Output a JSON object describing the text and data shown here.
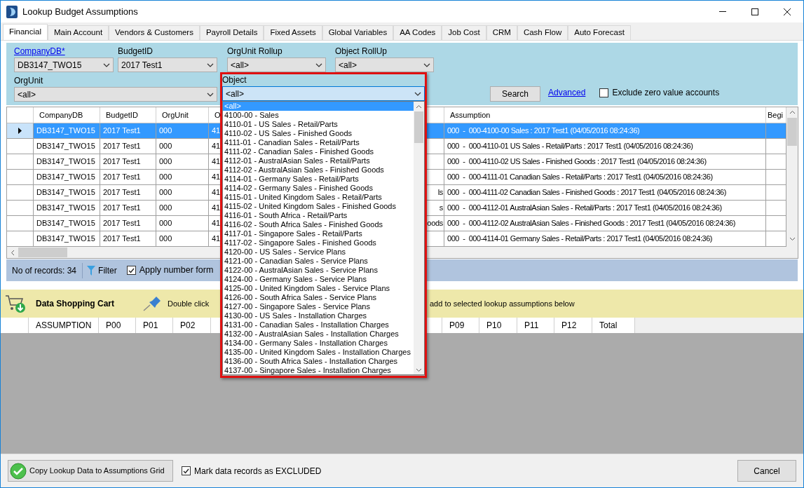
{
  "window": {
    "title": "Lookup Budget Assumptions"
  },
  "tabs": [
    {
      "label": "Financial",
      "selected": true
    },
    {
      "label": "Main Account",
      "selected": false
    },
    {
      "label": "Vendors & Customers",
      "selected": false
    },
    {
      "label": "Payroll Details",
      "selected": false
    },
    {
      "label": "Fixed Assets",
      "selected": false
    },
    {
      "label": "Global Variables",
      "selected": false
    },
    {
      "label": "AA Codes",
      "selected": false
    },
    {
      "label": "Job Cost",
      "selected": false
    },
    {
      "label": "CRM",
      "selected": false
    },
    {
      "label": "Cash Flow",
      "selected": false
    },
    {
      "label": "Auto Forecast",
      "selected": false
    }
  ],
  "filters": {
    "company_db": {
      "label": "CompanyDB*",
      "value": "DB3147_TWO15"
    },
    "budget_id": {
      "label": "BudgetID",
      "value": "2017 Test1"
    },
    "orgunit_rollup": {
      "label": "OrgUnit Rollup",
      "value": "<all>"
    },
    "object_rollup": {
      "label": "Object RollUp",
      "value": "<all>"
    },
    "orgunit": {
      "label": "OrgUnit",
      "value": "<all>"
    },
    "object": {
      "label": "Object",
      "value": "<all>",
      "expanded": true,
      "options": [
        {
          "label": "<all>",
          "selected": true
        },
        {
          "label": "4100-00 - Sales",
          "selected": false
        },
        {
          "label": "4110-01 - US Sales - Retail/Parts",
          "selected": false
        },
        {
          "label": "4110-02 - US Sales - Finished Goods",
          "selected": false
        },
        {
          "label": "4111-01 - Canadian Sales - Retail/Parts",
          "selected": false
        },
        {
          "label": "4111-02 - Canadian Sales - Finished Goods",
          "selected": false
        },
        {
          "label": "4112-01 - AustralAsian Sales - Retail/Parts",
          "selected": false
        },
        {
          "label": "4112-02 - AustralAsian Sales - Finished Goods",
          "selected": false
        },
        {
          "label": "4114-01 - Germany Sales - Retail/Parts",
          "selected": false
        },
        {
          "label": "4114-02 - Germany Sales - Finished Goods",
          "selected": false
        },
        {
          "label": "4115-01 - United Kingdom Sales - Retail/Parts",
          "selected": false
        },
        {
          "label": "4115-02 - United Kingdom Sales - Finished Goods",
          "selected": false
        },
        {
          "label": "4116-01 - South Africa - Retail/Parts",
          "selected": false
        },
        {
          "label": "4116-02 - South Africa Sales - Finished Goods",
          "selected": false
        },
        {
          "label": "4117-01 - Singapore Sales - Retail/Parts",
          "selected": false
        },
        {
          "label": "4117-02 - Singapore Sales - Finished Goods",
          "selected": false
        },
        {
          "label": "4120-00 - US Sales - Service Plans",
          "selected": false
        },
        {
          "label": "4121-00 - Canadian Sales - Service Plans",
          "selected": false
        },
        {
          "label": "4122-00 - AustralAsian Sales - Service Plans",
          "selected": false
        },
        {
          "label": "4124-00 - Germany Sales - Service Plans",
          "selected": false
        },
        {
          "label": "4125-00 - United Kingdom Sales - Service Plans",
          "selected": false
        },
        {
          "label": "4126-00 - South Africa Sales - Service Plans",
          "selected": false
        },
        {
          "label": "4127-00 - Singapore Sales - Service Plans",
          "selected": false
        },
        {
          "label": "4130-00 - US Sales - Installation Charges",
          "selected": false
        },
        {
          "label": "4131-00 - Canadian Sales - Installation Charges",
          "selected": false
        },
        {
          "label": "4132-00 - AustralAsian Sales - Installation Charges",
          "selected": false
        },
        {
          "label": "4134-00 - Germany Sales - Installation Charges",
          "selected": false
        },
        {
          "label": "4135-00 - United Kingdom Sales - Installation Charges",
          "selected": false
        },
        {
          "label": "4136-00 - South Africa Sales - Installation Charges",
          "selected": false
        },
        {
          "label": "4137-00 - Singapore Sales - Installation Charges",
          "selected": false
        }
      ]
    },
    "search_button": "Search",
    "advanced_link": "Advanced",
    "exclude_zero": {
      "label": "Exclude zero value accounts",
      "checked": false
    }
  },
  "grid": {
    "columns": [
      "CompanyDB",
      "BudgetID",
      "OrgUnit",
      "O",
      null,
      "Assumption",
      "Begi"
    ],
    "rows": [
      {
        "selected": true,
        "cells": [
          "DB3147_TWO15",
          "2017 Test1",
          "000",
          "41",
          null,
          "000  -  000-4100-00 Sales : 2017 Test1 (04/05/2016 08:24:36)"
        ]
      },
      {
        "selected": false,
        "cells": [
          "DB3147_TWO15",
          "2017 Test1",
          "000",
          "41",
          null,
          "000  -  000-4110-01 US Sales - Retail/Parts : 2017 Test1 (04/05/2016 08:24:36)"
        ]
      },
      {
        "selected": false,
        "cells": [
          "DB3147_TWO15",
          "2017 Test1",
          "000",
          "41",
          null,
          "000  -  000-4110-02 US Sales - Finished Goods : 2017 Test1 (04/05/2016 08:24:36)"
        ]
      },
      {
        "selected": false,
        "cells": [
          "DB3147_TWO15",
          "2017 Test1",
          "000",
          "41",
          null,
          "000  -  000-4111-01 Canadian Sales - Retail/Parts : 2017 Test1 (04/05/2016 08:24:36)"
        ]
      },
      {
        "selected": false,
        "cells": [
          "DB3147_TWO15",
          "2017 Test1",
          "000",
          "41",
          "ls",
          "000  -  000-4111-02 Canadian Sales - Finished Goods : 2017 Test1 (04/05/2016 08:24:36)"
        ]
      },
      {
        "selected": false,
        "cells": [
          "DB3147_TWO15",
          "2017 Test1",
          "000",
          "41",
          "s",
          "000  -  000-4112-01 AustralAsian Sales - Retail/Parts : 2017 Test1 (04/05/2016 08:24:36)"
        ]
      },
      {
        "selected": false,
        "cells": [
          "DB3147_TWO15",
          "2017 Test1",
          "000",
          "41",
          "oods",
          "000  -  000-4112-02 AustralAsian Sales - Finished Goods : 2017 Test1 (04/05/2016 08:24:36)"
        ]
      },
      {
        "selected": false,
        "cells": [
          "DB3147_TWO15",
          "2017 Test1",
          "000",
          "41",
          null,
          "000  -  000-4114-01 Germany Sales - Retail/Parts : 2017 Test1 (04/05/2016 08:24:36)"
        ]
      }
    ]
  },
  "status_bar": {
    "records": "No of records: 34",
    "filter": "Filter",
    "apply_format": {
      "label": "Apply number form",
      "checked": true
    }
  },
  "cart": {
    "title": "Data Shopping Cart",
    "hint_start": "Double click",
    "hint_end": "add to selected lookup assumptions below",
    "columns": [
      "ASSUMPTION",
      "P00",
      "P01",
      "P02",
      null,
      null,
      null,
      null,
      null,
      null,
      "P09",
      "P10",
      "P11",
      "P12",
      "Total"
    ]
  },
  "footer": {
    "copy_button": "Copy Lookup Data to Assumptions Grid",
    "mark_excluded": {
      "label": "Mark data records as EXCLUDED",
      "checked": true
    },
    "cancel_button": "Cancel"
  }
}
